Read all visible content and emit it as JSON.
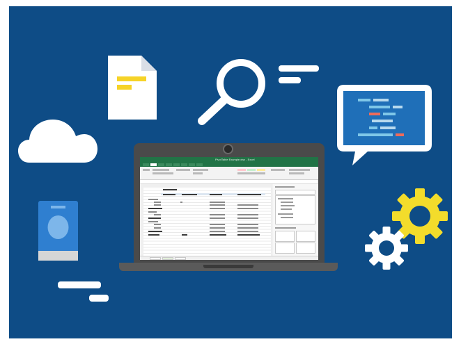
{
  "colors": {
    "background": "#0e4c86",
    "frame": "#ffffff",
    "laptop": "#4a4a4a",
    "excel_green": "#217346",
    "document": "#ffffff",
    "document_lines": "#f6d327",
    "gear_yellow": "#f3dc2b",
    "gear_white": "#ffffff",
    "phone_body": "#2f7fd0",
    "chat_screen": "#1f6fb8"
  },
  "icons": [
    "cloud-icon",
    "document-icon",
    "magnifying-glass-icon",
    "chat-bubble-code-icon",
    "phone-icon",
    "gear-large-icon",
    "gear-small-icon",
    "laptop-icon"
  ],
  "spreadsheet": {
    "title": "PivotTable Example.xlsx - Excel"
  }
}
